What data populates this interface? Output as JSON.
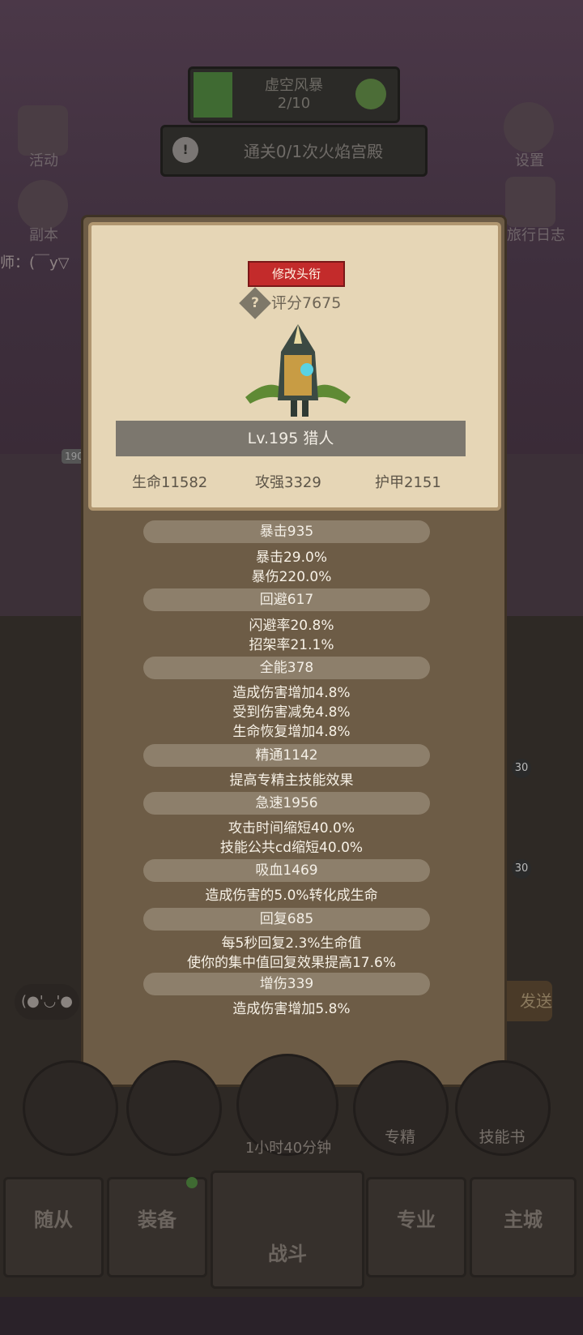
{
  "quest": {
    "title": "虚空风暴",
    "progress": "2/10"
  },
  "task": {
    "icon": "!",
    "text": "通关0/1次火焰宫殿"
  },
  "side_left": [
    {
      "label": "活动",
      "icon": "activity-icon"
    },
    {
      "label": "副本",
      "icon": "dungeon-icon"
    }
  ],
  "side_right": [
    {
      "label": "设置",
      "icon": "gear-icon"
    },
    {
      "label": "旅行日志",
      "icon": "journal-icon"
    }
  ],
  "background_fragments": {
    "chat_left": "师：(￣y▽",
    "level_badge": "190",
    "chat_face": "(●'◡'●",
    "send_partial": "发送",
    "badge_30a": "30",
    "badge_30b": "30",
    "timer": "1小时40分钟"
  },
  "modal": {
    "title_button": "修改头衔",
    "score_icon": "?",
    "score": "评分7675",
    "level_name": "Lv.195 猎人",
    "stats": {
      "hp": "生命11582",
      "attack": "攻强3329",
      "armor": "护甲2151"
    },
    "sections": [
      {
        "header": "暴击935",
        "lines": [
          "暴击29.0%",
          "暴伤220.0%"
        ]
      },
      {
        "header": "回避617",
        "lines": [
          "闪避率20.8%",
          "招架率21.1%"
        ]
      },
      {
        "header": "全能378",
        "lines": [
          "造成伤害增加4.8%",
          "受到伤害减免4.8%",
          "生命恢复增加4.8%"
        ]
      },
      {
        "header": "精通1142",
        "lines": [
          "提高专精主技能效果"
        ]
      },
      {
        "header": "急速1956",
        "lines": [
          "攻击时间缩短40.0%",
          "技能公共cd缩短40.0%"
        ]
      },
      {
        "header": "吸血1469",
        "lines": [
          "造成伤害的5.0%转化成生命"
        ]
      },
      {
        "header": "回复685",
        "lines": [
          "每5秒回复2.3%生命值",
          "使你的集中值回复效果提高17.6%"
        ]
      },
      {
        "header": "增伤339",
        "lines": [
          "造成伤害增加5.8%"
        ]
      }
    ]
  },
  "bottom_buttons": [
    {
      "label": ""
    },
    {
      "label": ""
    },
    {
      "label": ""
    },
    {
      "label": "专精"
    },
    {
      "label": "技能书"
    }
  ],
  "nav": [
    {
      "label": "随从"
    },
    {
      "label": "装备"
    },
    {
      "label": "战斗"
    },
    {
      "label": "专业"
    },
    {
      "label": "主城"
    }
  ]
}
